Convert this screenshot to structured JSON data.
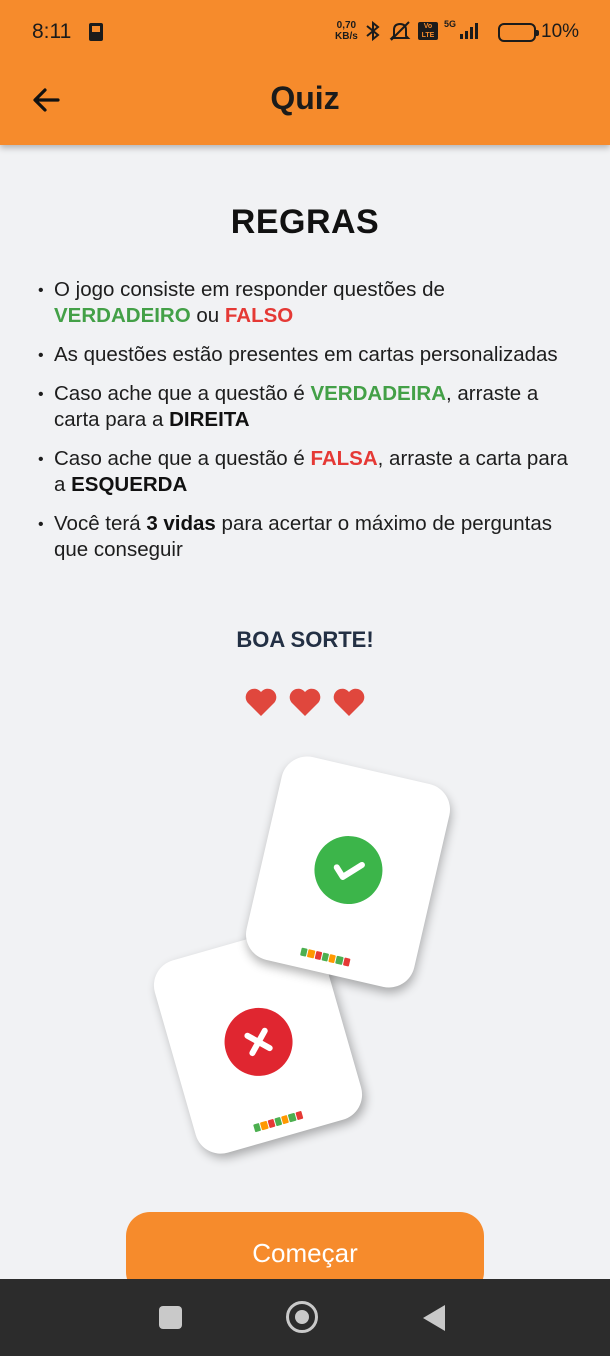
{
  "status_bar": {
    "time": "8:11",
    "net_speed_value": "0,70",
    "net_speed_unit": "KB/s",
    "volte_label": "Vo LTE",
    "network_label": "5G",
    "battery_level": "10%"
  },
  "header": {
    "title": "Quiz",
    "back_icon": "arrow-left-icon"
  },
  "rules": {
    "heading": "REGRAS",
    "items": [
      {
        "p1": "O jogo consiste em responder questões de ",
        "green": "VERDADEIRO",
        "p2": " ou ",
        "red": "FALSO"
      },
      {
        "p1": "As questões estão presentes em cartas personalizadas"
      },
      {
        "p1": "Caso ache que a questão é ",
        "green": "VERDADEIRA",
        "p2": ", arraste a carta para a ",
        "bold": "DIREITA"
      },
      {
        "p1": "Caso ache que a questão é ",
        "red": "FALSA",
        "p2": ", arraste a carta para a ",
        "bold": "ESQUERDA"
      },
      {
        "p1": "Você terá ",
        "bold": "3 vidas",
        "p2": " para acertar o máximo de perguntas que conseguir"
      }
    ]
  },
  "good_luck": "BOA SORTE!",
  "lives": {
    "count": 3,
    "icon": "heart-icon"
  },
  "cards": {
    "true_icon": "check-icon",
    "false_icon": "x-icon"
  },
  "start_button": {
    "label": "Começar"
  },
  "colors": {
    "accent": "#f68b2c",
    "true_green": "#43a047",
    "false_red": "#e53935",
    "heart": "#e0473d"
  }
}
